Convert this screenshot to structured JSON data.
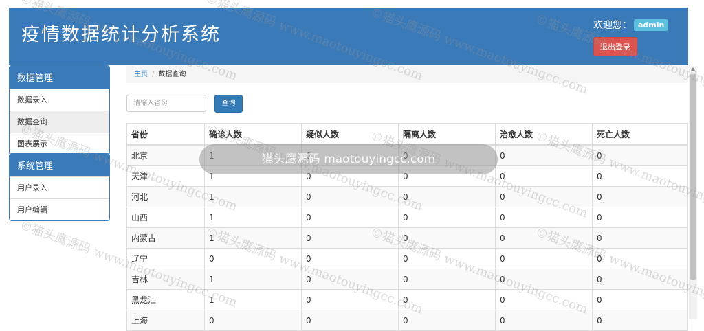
{
  "header": {
    "app_title": "疫情数据统计分析系统",
    "welcome_label": "欢迎您：",
    "username": "admin",
    "logout_label": "退出登录"
  },
  "sidebar": {
    "sections": [
      {
        "title": "数据管理",
        "items": [
          {
            "label": "数据录入"
          },
          {
            "label": "数据查询"
          },
          {
            "label": "图表展示"
          }
        ]
      },
      {
        "title": "系统管理",
        "items": [
          {
            "label": "用户录入"
          },
          {
            "label": "用户编辑"
          }
        ]
      }
    ]
  },
  "breadcrumb": {
    "home": "主页",
    "current": "数据查询"
  },
  "search": {
    "placeholder": "请输入省份",
    "value": "",
    "button_label": "查询"
  },
  "table": {
    "columns": [
      "省份",
      "确诊人数",
      "疑似人数",
      "隔离人数",
      "治愈人数",
      "死亡人数"
    ],
    "rows": [
      [
        "北京",
        "1",
        "0",
        "0",
        "0",
        "0"
      ],
      [
        "天津",
        "1",
        "0",
        "0",
        "0",
        "0"
      ],
      [
        "河北",
        "1",
        "0",
        "0",
        "0",
        "0"
      ],
      [
        "山西",
        "1",
        "0",
        "0",
        "0",
        "0"
      ],
      [
        "内蒙古",
        "1",
        "0",
        "0",
        "0",
        "0"
      ],
      [
        "辽宁",
        "0",
        "0",
        "0",
        "0",
        "0"
      ],
      [
        "吉林",
        "1",
        "0",
        "0",
        "0",
        "0"
      ],
      [
        "黑龙江",
        "1",
        "0",
        "0",
        "0",
        "0"
      ],
      [
        "上海",
        "0",
        "0",
        "0",
        "0",
        "0"
      ]
    ]
  },
  "overlay": {
    "toast_text": "猫头鹰源码 maotouyingcc.com",
    "watermark_text": "©猫头鹰源码 www.maotouyingcc.com"
  },
  "colors": {
    "header_bg": "#3a7ab8",
    "primary": "#337ab7",
    "danger": "#d9534f",
    "info": "#5bc0de"
  }
}
